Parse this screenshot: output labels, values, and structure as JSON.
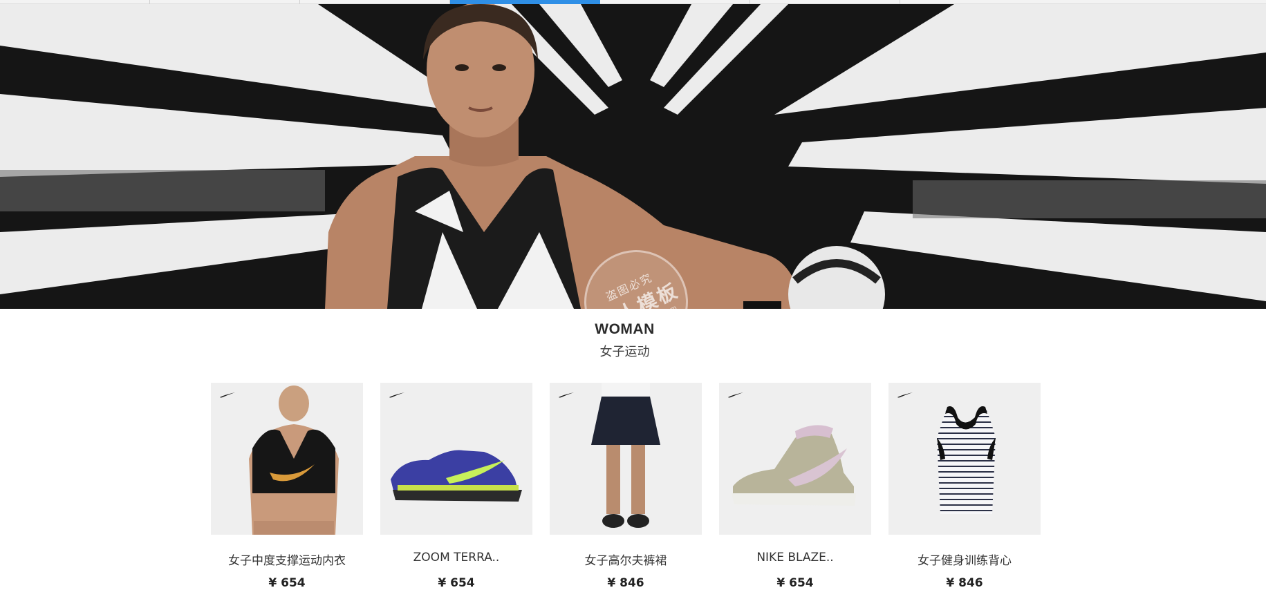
{
  "nav": {
    "tabs": [
      "",
      "",
      "",
      "",
      "",
      ""
    ],
    "active_index": 3
  },
  "hero": {
    "image": "woman-athlete-banner",
    "watermark": {
      "line1": "盗图必究",
      "line2": "懒人模板",
      "line3": "www.lanrenmb.com"
    }
  },
  "section": {
    "title": "WOMAN",
    "subtitle": "女子运动"
  },
  "products": [
    {
      "name": "女子中度支撑运动内衣",
      "price": "¥ 654",
      "image": "sports-bra"
    },
    {
      "name": "ZOOM TERRA..",
      "price": "¥ 654",
      "image": "running-shoe"
    },
    {
      "name": "女子高尔夫裤裙",
      "price": "¥ 846",
      "image": "golf-skort"
    },
    {
      "name": "NIKE BLAZE..",
      "price": "¥ 654",
      "image": "high-top-sneaker"
    },
    {
      "name": "女子健身训练背心",
      "price": "¥ 846",
      "image": "striped-tank"
    }
  ],
  "colors": {
    "active_tab": "#2f8fe6",
    "thumb_bg": "#efefef"
  }
}
